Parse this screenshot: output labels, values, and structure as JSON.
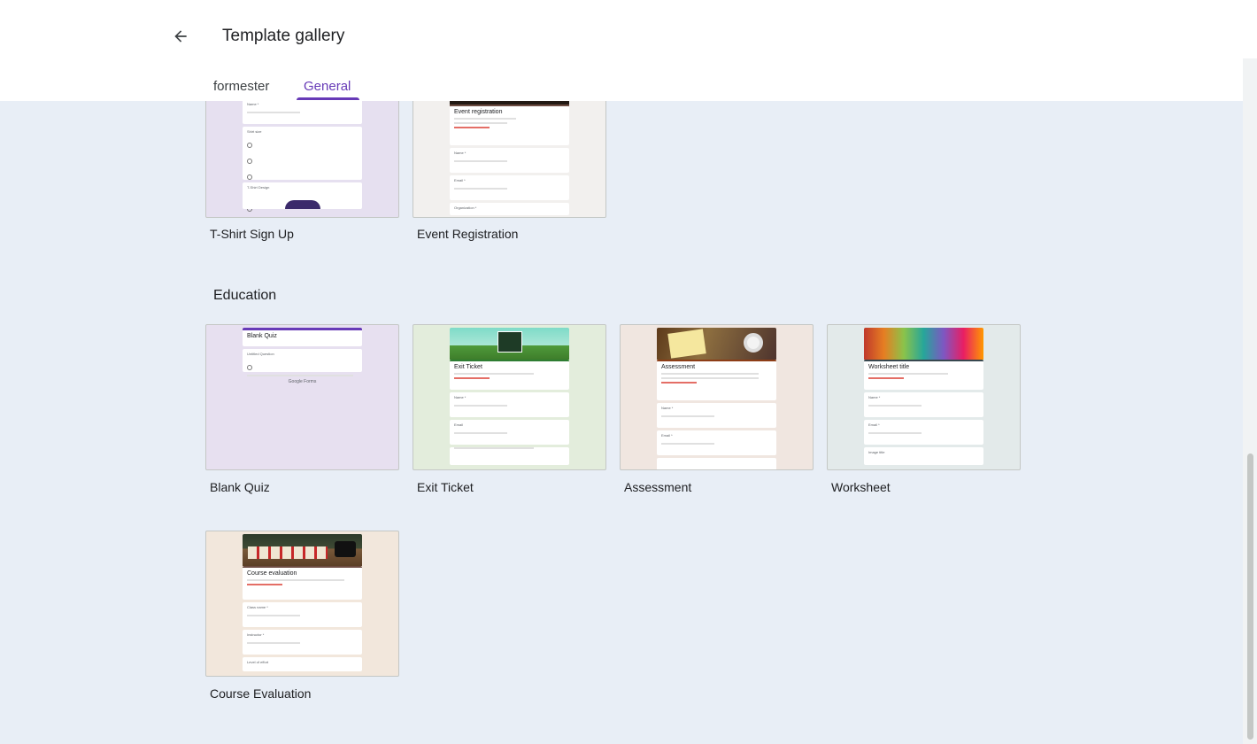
{
  "header": {
    "title": "Template gallery",
    "tabs": [
      {
        "label": "formester",
        "active": false
      },
      {
        "label": "General",
        "active": true
      }
    ]
  },
  "accent_color": "#673ab7",
  "sections": {
    "education_title": "Education"
  },
  "templates": {
    "tshirt": {
      "label": "T-Shirt Sign Up",
      "thumb_bg": "#e6e0f0"
    },
    "event": {
      "label": "Event Registration",
      "thumb_bg": "#f2f0ee",
      "form_title": "Event registration"
    },
    "blank_quiz": {
      "label": "Blank Quiz",
      "thumb_bg": "#e7e0f0",
      "form_title": "Blank Quiz",
      "footer": "Google Forms"
    },
    "exit_ticket": {
      "label": "Exit Ticket",
      "thumb_bg": "#e3eddc",
      "form_title": "Exit Ticket"
    },
    "assessment": {
      "label": "Assessment",
      "thumb_bg": "#f0e6e0",
      "form_title": "Assessment"
    },
    "worksheet": {
      "label": "Worksheet",
      "thumb_bg": "#e3eaea",
      "form_title": "Worksheet title"
    },
    "course_eval": {
      "label": "Course Evaluation",
      "thumb_bg": "#f2e7dc",
      "form_title": "Course evaluation"
    }
  },
  "icons": {
    "back": "arrow-left-icon"
  }
}
